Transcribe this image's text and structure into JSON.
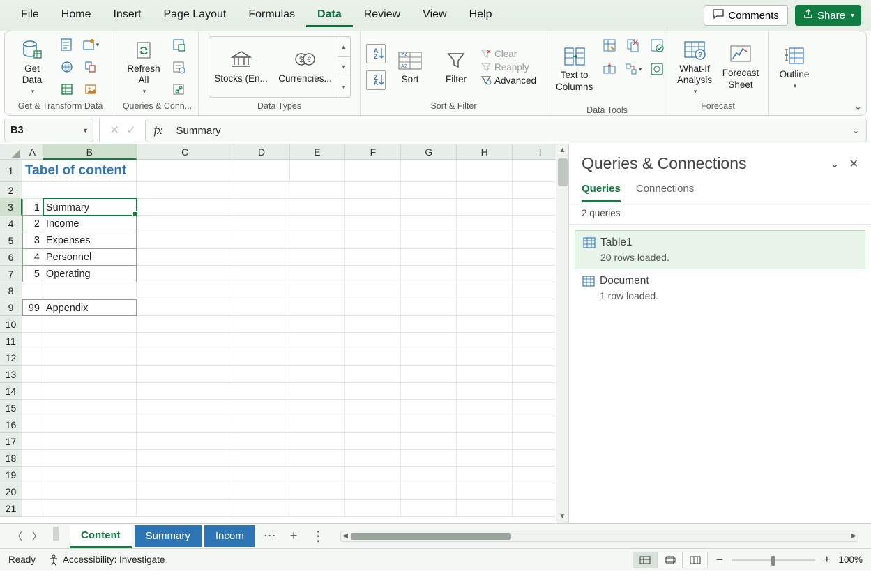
{
  "menubar": {
    "items": [
      "File",
      "Home",
      "Insert",
      "Page Layout",
      "Formulas",
      "Data",
      "Review",
      "View",
      "Help"
    ],
    "active": "Data",
    "comments": "Comments",
    "share": "Share"
  },
  "ribbon": {
    "groups": {
      "get_transform": {
        "label": "Get & Transform Data",
        "get_data": "Get\nData"
      },
      "queries_conn": {
        "label": "Queries & Conn...",
        "refresh": "Refresh\nAll"
      },
      "data_types": {
        "label": "Data Types",
        "stocks": "Stocks (En...",
        "currencies": "Currencies..."
      },
      "sort_filter": {
        "label": "Sort & Filter",
        "sort": "Sort",
        "filter": "Filter",
        "clear": "Clear",
        "reapply": "Reapply",
        "advanced": "Advanced"
      },
      "data_tools": {
        "label": "Data Tools",
        "text_cols": "Text to\nColumns"
      },
      "forecast": {
        "label": "Forecast",
        "whatif": "What-If\nAnalysis",
        "sheet": "Forecast\nSheet"
      },
      "outline": {
        "label": "",
        "outline": "Outline"
      }
    }
  },
  "namebox": "B3",
  "formula": "Summary",
  "grid": {
    "columns": [
      "A",
      "B",
      "C",
      "D",
      "E",
      "F",
      "G",
      "H",
      "I"
    ],
    "title": "Tabel of content",
    "toc": [
      {
        "n": "1",
        "label": "Summary"
      },
      {
        "n": "2",
        "label": "Income"
      },
      {
        "n": "3",
        "label": "Expenses"
      },
      {
        "n": "4",
        "label": "Personnel"
      },
      {
        "n": "5",
        "label": "Operating"
      }
    ],
    "appendix": {
      "n": "99",
      "label": "Appendix"
    },
    "selected_cell": "B3",
    "row_count": 21
  },
  "panel": {
    "title": "Queries & Connections",
    "tabs": [
      "Queries",
      "Connections"
    ],
    "active_tab": "Queries",
    "summary": "2 queries",
    "queries": [
      {
        "name": "Table1",
        "status": "20 rows loaded.",
        "selected": true
      },
      {
        "name": "Document",
        "status": "1 row loaded.",
        "selected": false
      }
    ]
  },
  "sheets": {
    "tabs": [
      {
        "name": "Content",
        "style": "active"
      },
      {
        "name": "Summary",
        "style": "colored"
      },
      {
        "name": "Incom",
        "style": "colored"
      }
    ]
  },
  "statusbar": {
    "ready": "Ready",
    "accessibility": "Accessibility: Investigate",
    "zoom": "100%"
  }
}
